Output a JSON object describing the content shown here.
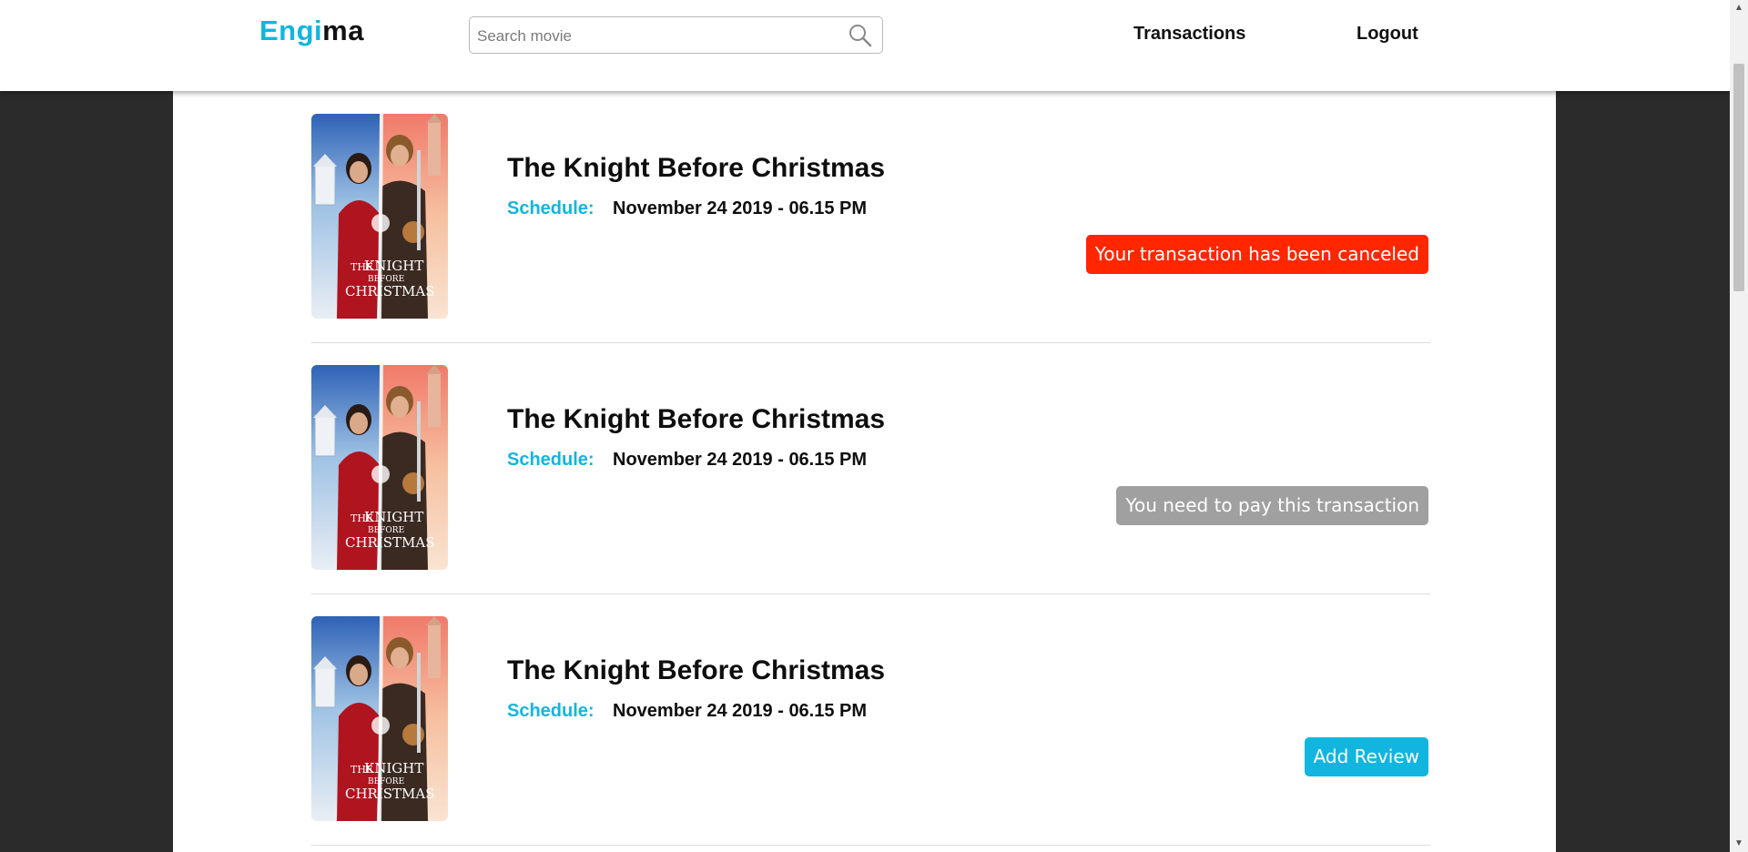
{
  "header": {
    "logo_part1": "Engi",
    "logo_part2": "ma",
    "search_placeholder": "Search movie",
    "nav_transactions": "Transactions",
    "nav_logout": "Logout"
  },
  "colors": {
    "accent": "#12b5e0",
    "canceled": "#ff2600",
    "pending": "#a0a0a0"
  },
  "transactions": [
    {
      "title": "The Knight Before Christmas",
      "schedule_label": "Schedule:",
      "schedule_value": "November 24 2019 - 06.15 PM",
      "status": "Your transaction has been canceled"
    },
    {
      "title": "The Knight Before Christmas",
      "schedule_label": "Schedule:",
      "schedule_value": "November 24 2019 - 06.15 PM",
      "status": "You need to pay this transaction"
    },
    {
      "title": "The Knight Before Christmas",
      "schedule_label": "Schedule:",
      "schedule_value": "November 24 2019 - 06.15 PM",
      "status": "Add Review"
    }
  ],
  "poster": {
    "line1": "THE",
    "line2": "KNIGHT",
    "line3": "BEFORE",
    "line4": "CHRISTMAS"
  },
  "icons": {
    "search": "search-icon",
    "poster": "movie-poster",
    "scroll_up": "scroll-up-arrow-icon",
    "scroll_down": "scroll-down-arrow-icon"
  }
}
